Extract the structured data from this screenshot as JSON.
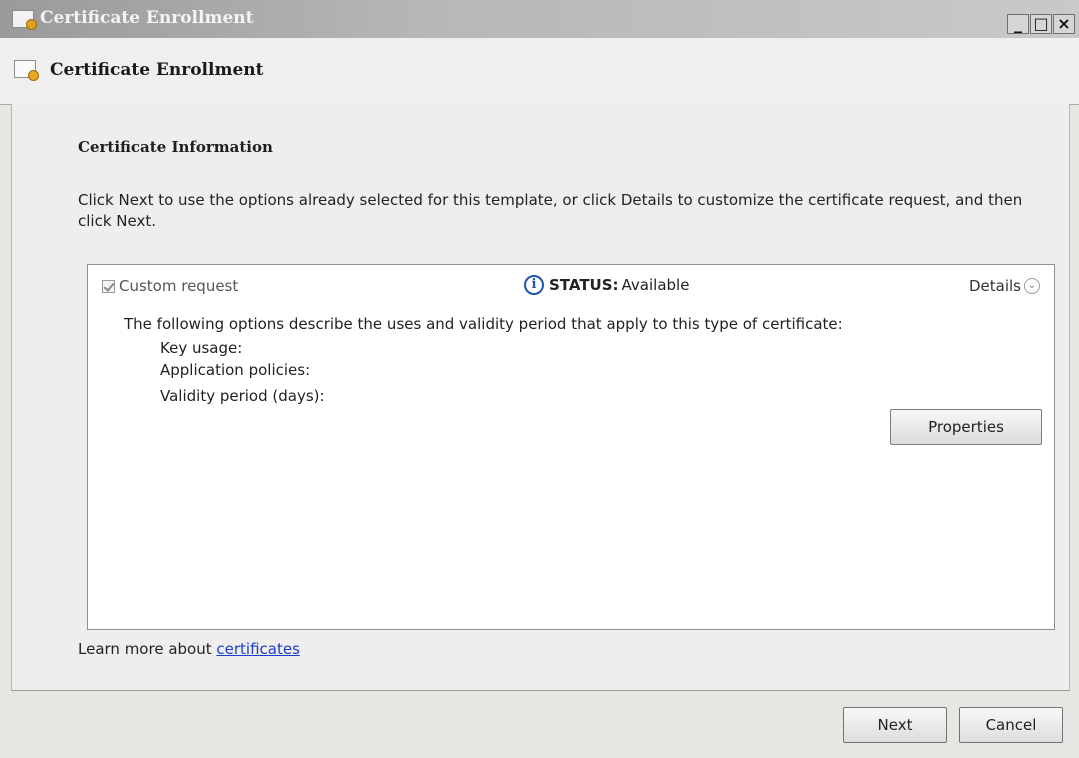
{
  "window": {
    "title": "Certificate Enrollment",
    "controls": {
      "minimize": "_",
      "maximize": "□",
      "close": "×"
    }
  },
  "header": {
    "title": "Certificate Enrollment"
  },
  "section": {
    "title": "Certificate Information",
    "instructions": "Click Next to use the options already selected for this template, or click Details to customize the certificate request, and then click Next."
  },
  "certificate": {
    "checkbox_label": "Custom request",
    "checked": true,
    "status_key": "STATUS:",
    "status_value": "Available",
    "details_label": "Details",
    "description": "The following options describe the uses and validity period that apply to this type of certificate:",
    "fields": {
      "key_usage": "Key usage:",
      "application_policies": "Application policies:",
      "validity_period": "Validity period (days):"
    },
    "properties_button": "Properties"
  },
  "learn_more": {
    "prefix": "Learn more about",
    "link": "certificates"
  },
  "footer": {
    "next_label": "Next",
    "cancel_label": "Cancel"
  },
  "icons": {
    "title": "certificate-icon",
    "header": "certificate-icon",
    "status": "info-icon",
    "details": "chevron-down-circle-icon"
  }
}
